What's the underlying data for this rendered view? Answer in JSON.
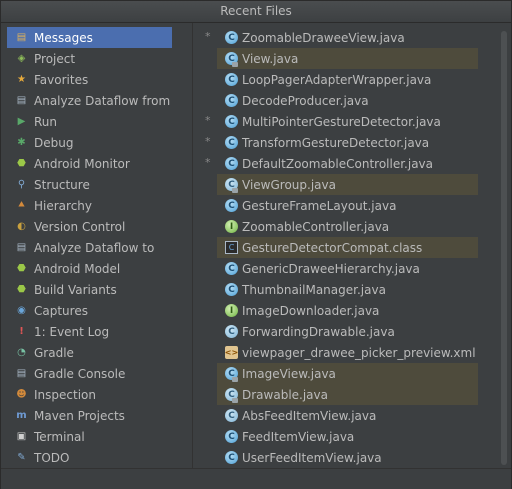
{
  "window": {
    "title": "Recent Files"
  },
  "tool_windows": [
    {
      "label": "Messages",
      "icon": "messages-icon",
      "glyph": "▤",
      "color": "#e0b35a",
      "selected": true
    },
    {
      "label": "Project",
      "icon": "project-icon",
      "glyph": "◈",
      "color": "#8fbf5a"
    },
    {
      "label": "Favorites",
      "icon": "favorites-icon",
      "glyph": "★",
      "color": "#e5a93c"
    },
    {
      "label": "Analyze Dataflow from",
      "icon": "dataflow-icon",
      "glyph": "▤",
      "color": "#a9b7c6"
    },
    {
      "label": "Run",
      "icon": "run-icon",
      "glyph": "▶",
      "color": "#59a869"
    },
    {
      "label": "Debug",
      "icon": "debug-icon",
      "glyph": "✱",
      "color": "#59a869"
    },
    {
      "label": "Android Monitor",
      "icon": "android-monitor-icon",
      "glyph": "⬣",
      "color": "#9bc848"
    },
    {
      "label": "Structure",
      "icon": "structure-icon",
      "glyph": "⚲",
      "color": "#7fa7cf"
    },
    {
      "label": "Hierarchy",
      "icon": "hierarchy-icon",
      "glyph": "⯅",
      "color": "#d38a3b"
    },
    {
      "label": "Version Control",
      "icon": "version-control-icon",
      "glyph": "◐",
      "color": "#c9a13e"
    },
    {
      "label": "Analyze Dataflow to",
      "icon": "dataflow-to-icon",
      "glyph": "▤",
      "color": "#a9b7c6"
    },
    {
      "label": "Android Model",
      "icon": "android-model-icon",
      "glyph": "⬣",
      "color": "#9bc848"
    },
    {
      "label": "Build Variants",
      "icon": "build-variants-icon",
      "glyph": "⬣",
      "color": "#9bc848"
    },
    {
      "label": "Captures",
      "icon": "captures-icon",
      "glyph": "◉",
      "color": "#6aa5d9"
    },
    {
      "label": "1: Event Log",
      "icon": "event-log-icon",
      "glyph": "!",
      "color": "#e05555"
    },
    {
      "label": "Gradle",
      "icon": "gradle-icon",
      "glyph": "◔",
      "color": "#78c2a4"
    },
    {
      "label": "Gradle Console",
      "icon": "gradle-console-icon",
      "glyph": "▤",
      "color": "#a9b7c6"
    },
    {
      "label": "Inspection",
      "icon": "inspection-icon",
      "glyph": "☻",
      "color": "#d38a3b"
    },
    {
      "label": "Maven Projects",
      "icon": "maven-icon",
      "glyph": "m",
      "color": "#6f9bd4"
    },
    {
      "label": "Terminal",
      "icon": "terminal-icon",
      "glyph": "▣",
      "color": "#d0d0d0"
    },
    {
      "label": "TODO",
      "icon": "todo-icon",
      "glyph": "✎",
      "color": "#7fa7cf"
    }
  ],
  "recent_files": [
    {
      "name": "ZoomableDraweeView.java",
      "kind": "class",
      "starred": true
    },
    {
      "name": "View.java",
      "kind": "class-locked",
      "highlighted": true
    },
    {
      "name": "LoopPagerAdapterWrapper.java",
      "kind": "class"
    },
    {
      "name": "DecodeProducer.java",
      "kind": "class"
    },
    {
      "name": "MultiPointerGestureDetector.java",
      "kind": "class",
      "starred": true
    },
    {
      "name": "TransformGestureDetector.java",
      "kind": "class",
      "starred": true
    },
    {
      "name": "DefaultZoomableController.java",
      "kind": "class",
      "starred": true
    },
    {
      "name": "ViewGroup.java",
      "kind": "abstract-locked",
      "highlighted": true
    },
    {
      "name": "GestureFrameLayout.java",
      "kind": "class"
    },
    {
      "name": "ZoomableController.java",
      "kind": "interface"
    },
    {
      "name": "GestureDetectorCompat.class",
      "kind": "library",
      "highlighted": true
    },
    {
      "name": "GenericDraweeHierarchy.java",
      "kind": "class"
    },
    {
      "name": "ThumbnailManager.java",
      "kind": "class"
    },
    {
      "name": "ImageDownloader.java",
      "kind": "interface"
    },
    {
      "name": "ForwardingDrawable.java",
      "kind": "abstract"
    },
    {
      "name": "viewpager_drawee_picker_preview.xml",
      "kind": "xml"
    },
    {
      "name": "ImageView.java",
      "kind": "class-locked",
      "highlighted": true
    },
    {
      "name": "Drawable.java",
      "kind": "abstract-locked",
      "highlighted": true
    },
    {
      "name": "AbsFeedItemView.java",
      "kind": "abstract"
    },
    {
      "name": "FeedItemView.java",
      "kind": "class"
    },
    {
      "name": "UserFeedItemView.java",
      "kind": "class"
    }
  ]
}
